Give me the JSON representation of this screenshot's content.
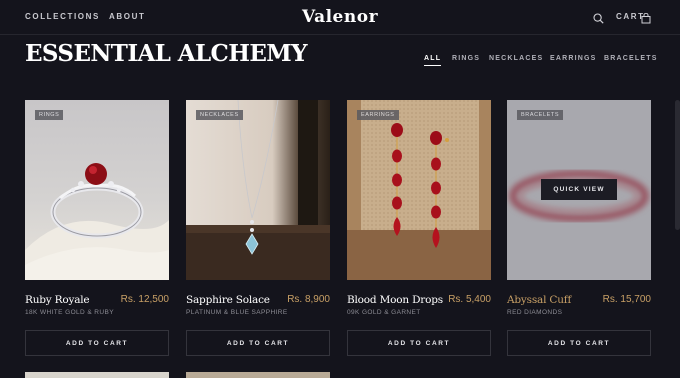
{
  "header": {
    "nav": [
      "COLLECTIONS",
      "ABOUT"
    ],
    "brand": "Valenor",
    "cart_label": "CART",
    "icons": [
      "search-icon",
      "shopping-bag-icon"
    ]
  },
  "page": {
    "title": "ESSENTIAL ALCHEMY",
    "filters": [
      "ALL",
      "RINGS",
      "NECKLACES",
      "EARRINGS",
      "BRACELETS"
    ],
    "active_filter": "ALL"
  },
  "products": [
    {
      "badge": "RINGS",
      "name": "Ruby Royale",
      "price": "Rs. 12,500",
      "material": "18K WHITE GOLD & RUBY",
      "button": "ADD TO CART"
    },
    {
      "badge": "NECKLACES",
      "name": "Sapphire Solace",
      "price": "Rs. 8,900",
      "material": "PLATINUM & BLUE SAPPHIRE",
      "button": "ADD TO CART"
    },
    {
      "badge": "EARRINGS",
      "name": "Blood Moon Drops",
      "price": "Rs. 5,400",
      "material": "09K GOLD & GARNET",
      "button": "ADD TO CART"
    },
    {
      "badge": "BRACELETS",
      "name": "Abyssal Cuff",
      "price": "Rs. 15,700",
      "material": "RED DIAMONDS",
      "button": "ADD TO CART",
      "quick_view": "QUICK VIEW"
    }
  ],
  "colors": {
    "background": "#14141c",
    "accent_gold": "#c8a066",
    "text": "#ffffff",
    "muted": "#8c8c94"
  }
}
